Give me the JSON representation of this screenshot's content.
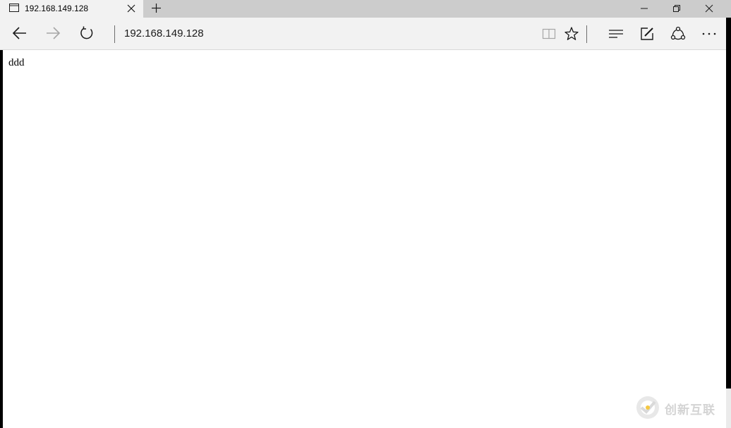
{
  "tab": {
    "title": "192.168.149.128"
  },
  "address_bar": {
    "url": "192.168.149.128"
  },
  "page": {
    "content": "ddd"
  },
  "watermark": {
    "text": "创新互联"
  },
  "icons": {
    "tab_favicon": "page-icon",
    "tab_close": "close-icon",
    "new_tab": "plus-icon",
    "minimize": "minimize-icon",
    "restore": "restore-icon",
    "close_window": "close-icon",
    "back": "arrow-left-icon",
    "forward": "arrow-right-icon",
    "refresh": "refresh-icon",
    "reading_view": "book-icon",
    "favorite": "star-icon",
    "hub": "hub-icon",
    "web_note": "pen-icon",
    "share": "share-icon",
    "more": "more-icon"
  },
  "colors": {
    "tab_active_bg": "#f2f2f2",
    "tabbar_bg": "#cccccc",
    "navbar_bg": "#f2f2f2",
    "page_bg": "#ffffff",
    "icon_color": "#1a1a1a",
    "disabled_icon_color": "#a6a6a6"
  }
}
